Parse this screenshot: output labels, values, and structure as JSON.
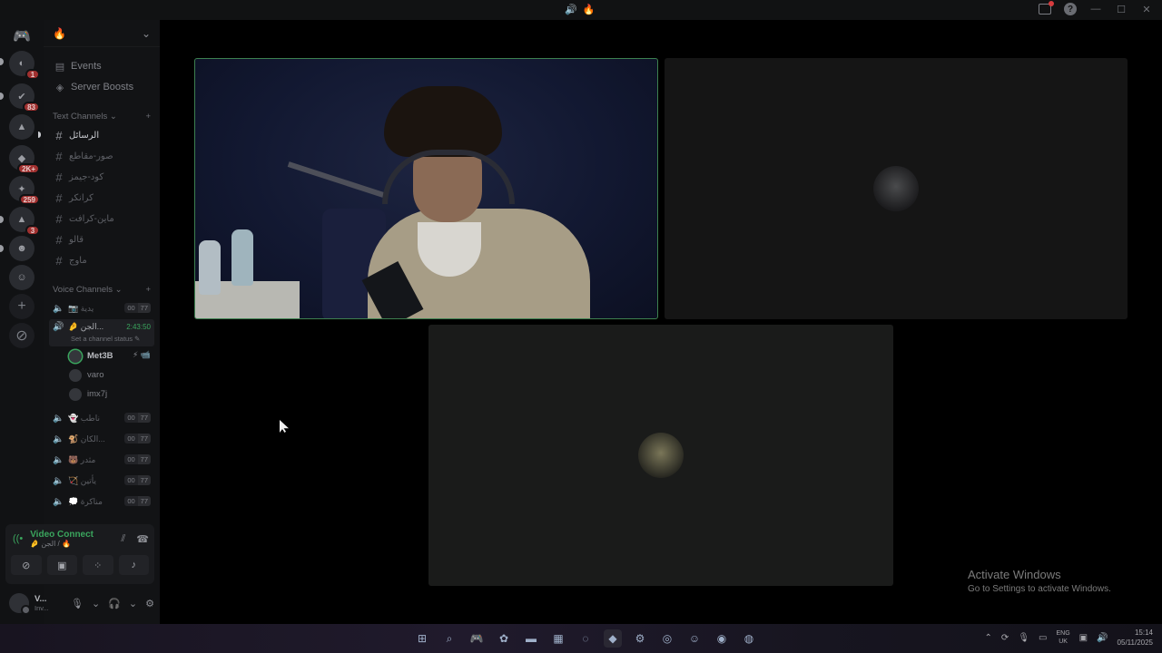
{
  "titlebar": {
    "server_icon": "🔥",
    "help": "?",
    "window_controls": [
      "—",
      "☐",
      "✕"
    ]
  },
  "rail": {
    "servers": [
      {
        "badge": "1"
      },
      {
        "badge": "83"
      },
      {
        "badge": ""
      },
      {
        "badge": "2K+"
      },
      {
        "badge": "259"
      },
      {
        "badge": "3"
      },
      {
        "badge": ""
      },
      {
        "badge": ""
      }
    ]
  },
  "sidebar": {
    "server_name": "🔥",
    "events_label": "Events",
    "boosts_label": "Server Boosts",
    "text_category": "Text Channels",
    "text_channels": [
      "الرسائل",
      "صور-مقاطع",
      "كود-جيمز",
      "كرانكر",
      "ماين-كرافت",
      "قالو",
      "ماوج"
    ],
    "voice_category": "Voice Channels",
    "voice_top": {
      "name": "📷 يدية",
      "count_a": "00",
      "count_b": "77"
    },
    "active_voice": {
      "name": "🤌 الجن...",
      "timer": "2:43:50",
      "status": "Set a channel status ✎"
    },
    "members": [
      {
        "name": "Met3B",
        "extra": "⚡ 📹"
      },
      {
        "name": "varo",
        "extra": ""
      },
      {
        "name": "imx7j",
        "extra": ""
      }
    ],
    "voice_channels": [
      {
        "name": "👻 ناطب",
        "count_a": "00",
        "count_b": "77"
      },
      {
        "name": "🐒 الكان...",
        "count_a": "00",
        "count_b": "77"
      },
      {
        "name": "🐻 مثدر",
        "count_a": "00",
        "count_b": "77"
      },
      {
        "name": "🏹 يأتين",
        "count_a": "00",
        "count_b": "77"
      },
      {
        "name": "💭 مناكرة",
        "count_a": "00",
        "count_b": "77"
      }
    ]
  },
  "voice_panel": {
    "title": "Video Connected",
    "subtitle": "🤌 الجن / 🔥"
  },
  "user": {
    "display_name": "V...",
    "status": "Inv..."
  },
  "watermark": {
    "line1": "Activate Windows",
    "line2": "Go to Settings to activate Windows."
  },
  "tray": {
    "lang1": "ENG",
    "lang2": "UK",
    "time": "15:14",
    "date": "05/11/2025"
  }
}
